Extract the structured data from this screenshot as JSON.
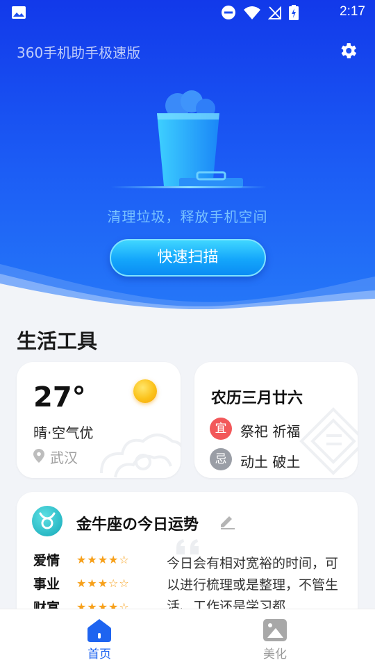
{
  "status_bar": {
    "time": "2:17"
  },
  "header": {
    "app_title": "360手机助手极速版"
  },
  "hero": {
    "tagline": "清理垃圾，释放手机空间",
    "scan_button": "快速扫描"
  },
  "section": {
    "title": "生活工具"
  },
  "weather": {
    "temperature": "27°",
    "description": "晴·空气优",
    "city": "武汉"
  },
  "calendar": {
    "lunar_date": "农历三月廿六",
    "yi_badge": "宜",
    "yi_text": "祭祀 祈福",
    "ji_badge": "忌",
    "ji_text": "动土 破土"
  },
  "horoscope": {
    "title": "金牛座の今日运势",
    "ratings": [
      {
        "label": "爱情",
        "stars": "★★★★☆"
      },
      {
        "label": "事业",
        "stars": "★★★☆☆"
      },
      {
        "label": "财富",
        "stars": "★★★★☆"
      }
    ],
    "text": "今日会有相对宽裕的时间，可以进行梳理或是整理，不管生活、工作还是学习都…"
  },
  "bottom_nav": {
    "items": [
      {
        "label": "首页",
        "active": true
      },
      {
        "label": "美化",
        "active": false
      }
    ]
  },
  "colors": {
    "hero_blue": "#1c5df5",
    "accent_blue": "#1e64f0",
    "star": "#f7a01a",
    "yi": "#f2585a",
    "ji": "#9a9ea6"
  }
}
